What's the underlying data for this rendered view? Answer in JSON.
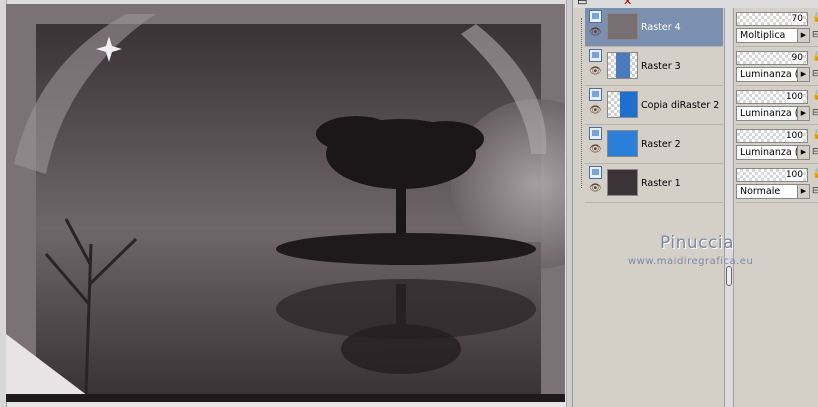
{
  "layers": [
    {
      "name": "Raster 4",
      "opacity": "70",
      "blend_mode": "Moltiplica",
      "selected": true,
      "thumb": "#776f72"
    },
    {
      "name": "Raster 3",
      "opacity": "90",
      "blend_mode": "Luminanza (L)",
      "selected": false,
      "thumb": "#3b6fb8"
    },
    {
      "name": "Copia diRaster 2",
      "opacity": "100",
      "blend_mode": "Luminanza (L)",
      "selected": false,
      "thumb": "#1e6fd0"
    },
    {
      "name": "Raster 2",
      "opacity": "100",
      "blend_mode": "Luminanza (L)",
      "selected": false,
      "thumb": "#2c7fd8"
    },
    {
      "name": "Raster 1",
      "opacity": "100",
      "blend_mode": "Normale",
      "selected": false,
      "thumb": "#3b3335"
    }
  ],
  "watermark": {
    "title": "Pinuccia",
    "url": "www.maidiregrafica.eu"
  },
  "icons": {
    "raster": "raster-layer-icon",
    "visibility": "eye-icon",
    "opacity_lock": "lock-icon",
    "blend_dropdown": "chevron-right-icon"
  },
  "colors": {
    "selected_row": "#7b8fb1",
    "panel_bg": "#d4d0c8",
    "watermark": "#7a8aa8"
  }
}
